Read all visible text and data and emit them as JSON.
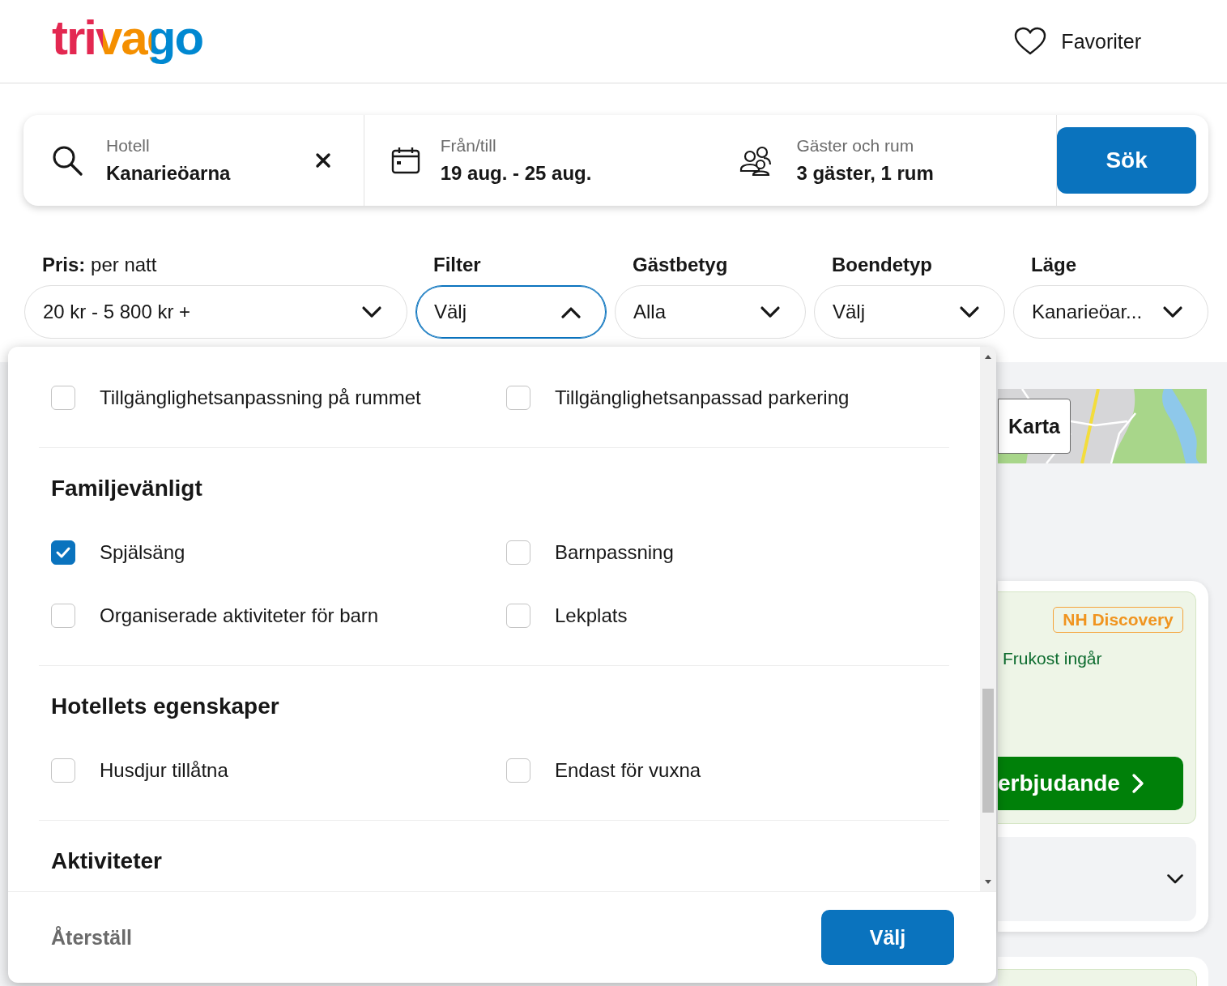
{
  "header": {
    "logo": "trivago",
    "favorites": "Favoriter"
  },
  "search": {
    "fields": [
      {
        "kind": "destination",
        "label": "Hotell",
        "value": "Kanarieöarna"
      },
      {
        "kind": "dates",
        "label": "Från/till",
        "value": "19 aug. - 25 aug."
      },
      {
        "kind": "guests",
        "label": "Gäster och rum",
        "value": "3 gäster, 1 rum"
      }
    ],
    "button": "Sök"
  },
  "filters": [
    {
      "label": "**Pris:** per natt",
      "value": "20 kr - 5 800 kr +",
      "expanded": false
    },
    {
      "label": "Filter",
      "value": "Välj",
      "expanded": true
    },
    {
      "label": "Gästbetyg",
      "value": "Alla",
      "expanded": false
    },
    {
      "label": "Boendetyp",
      "value": "Välj",
      "expanded": false
    },
    {
      "label": "Läge",
      "value": "Kanarieöar...",
      "expanded": false
    }
  ],
  "filter_panel": {
    "sections": [
      {
        "options": [
          {
            "label": "Tillgänglighetsanpassning på rummet",
            "checked": false
          },
          {
            "label": "Tillgänglighetsanpassad parkering",
            "checked": false
          }
        ]
      },
      {
        "heading": "Familjevänligt",
        "options": [
          {
            "label": "Spjälsäng",
            "checked": true
          },
          {
            "label": "Barnpassning",
            "checked": false
          },
          {
            "label": "Organiserade aktiviteter för barn",
            "checked": false
          },
          {
            "label": "Lekplats",
            "checked": false
          }
        ]
      },
      {
        "heading": "Hotellets egenskaper",
        "options": [
          {
            "label": "Husdjur tillåtna",
            "checked": false
          },
          {
            "label": "Endast för vuxna",
            "checked": false
          }
        ]
      },
      {
        "heading": "Aktiviteter"
      }
    ],
    "reset": "Återställ",
    "apply": "Välj"
  },
  "results": {
    "map_button": "Karta",
    "badge": "NH Discovery",
    "perk": "Frukost ingår",
    "deal_button": "erbjudande"
  }
}
